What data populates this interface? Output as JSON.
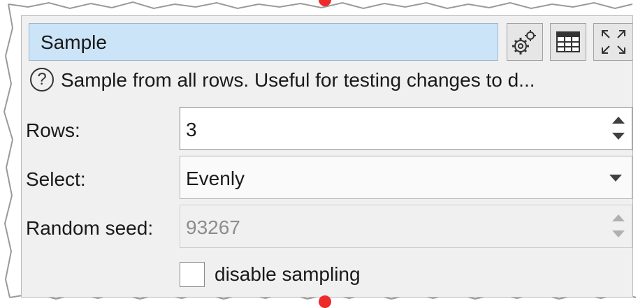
{
  "panel": {
    "title": "Sample",
    "help_text": "Sample from all rows. Useful for testing changes to d...",
    "toolbar": {
      "settings_icon": "gear-icon",
      "table_icon": "table-icon",
      "maximize_icon": "maximize-icon"
    }
  },
  "form": {
    "rows": {
      "label": "Rows:",
      "value": "3"
    },
    "select": {
      "label": "Select:",
      "value": "Evenly"
    },
    "seed": {
      "label": "Random seed:",
      "value": "93267"
    },
    "disable_sampling": {
      "label": "disable sampling",
      "checked": false
    }
  },
  "colors": {
    "title_bar": "#cce4f7",
    "connector": "#ee2b2b"
  }
}
